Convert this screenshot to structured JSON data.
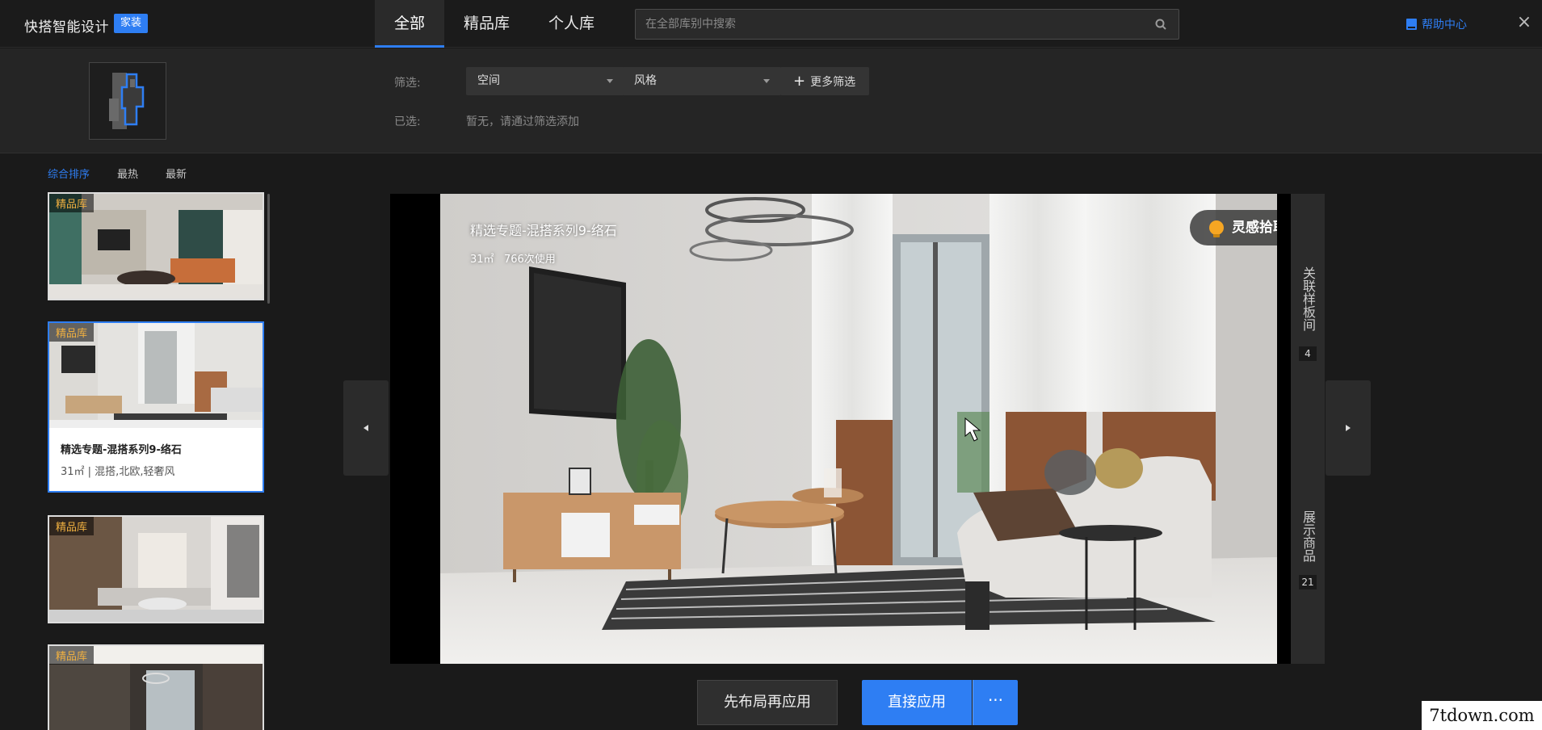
{
  "header": {
    "brand": "快搭智能设计",
    "brand_tag": "家装",
    "tabs": [
      {
        "label": "全部",
        "active": true
      },
      {
        "label": "精品库",
        "active": false
      },
      {
        "label": "个人库",
        "active": false
      }
    ],
    "search_placeholder": "在全部库别中搜索",
    "help_label": "帮助中心",
    "close_symbol": "×"
  },
  "filters": {
    "filter_label": "筛选:",
    "space_dropdown": "空间",
    "style_dropdown": "风格",
    "more_filter": "更多筛选",
    "selected_label": "已选:",
    "selected_hint": "暂无，请通过筛选添加"
  },
  "sort": {
    "options": [
      "综合排序",
      "最热",
      "最新"
    ],
    "active_index": 0
  },
  "cards": [
    {
      "badge": "精品库"
    },
    {
      "badge": "精品库",
      "title": "精选专题-混搭系列9-络石",
      "subtitle": "31㎡ | 混搭,北欧,轻奢风"
    },
    {
      "badge": "精品库"
    },
    {
      "badge": "精品库"
    }
  ],
  "viewer": {
    "title": "精选专题-混搭系列9-络石",
    "area": "31㎡",
    "usage": "766次使用",
    "inspire_label": "灵感拾取"
  },
  "side_panel": {
    "related_label": "关联样板间",
    "related_count": "4",
    "products_label": "展示商品",
    "products_count": "21"
  },
  "actions": {
    "layout_first": "先布局再应用",
    "apply_direct": "直接应用",
    "more": "···"
  },
  "watermark": "7tdown.com",
  "colors": {
    "accent": "#2e7ef3",
    "badge": "#f0b040",
    "bulb": "#f6a623"
  }
}
